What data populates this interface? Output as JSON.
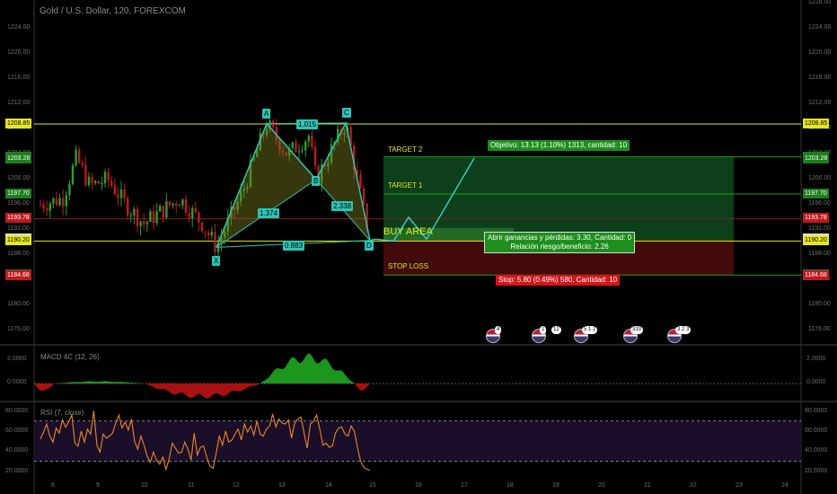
{
  "header": {
    "symbol_title": "Gold / U.S. Dollar, 120, FOREXCOM"
  },
  "colors": {
    "background": "#000000",
    "up": "#2e9e2e",
    "down": "#c0191c",
    "pattern": "#2ec4b6",
    "level": "#e6e61e",
    "target_zone": "#0f4a1e",
    "stop_zone": "#4a0b0b",
    "rsi": "#e8872a",
    "macd_pos": "#1e9e1e",
    "macd_neg": "#b01212"
  },
  "price_axis": {
    "ticks": [
      "1224.00",
      "1220.00",
      "1216.00",
      "1212.00",
      "1208.00",
      "1204.00",
      "1200.00",
      "1196.00",
      "1192.00",
      "1188.00",
      "1184.00",
      "1180.00",
      "1176.00"
    ],
    "right_ticks": [
      "1228.00",
      "1224.00",
      "1220.00",
      "1216.00",
      "1212.00",
      "1208.00",
      "1204.00",
      "1200.00",
      "1196.00",
      "1192.00",
      "1188.00",
      "1184.00",
      "1180.00",
      "1176.00"
    ],
    "ymin": 1173.8,
    "ymax": 1228.6
  },
  "price_labels": [
    {
      "v": "1208.85",
      "price": 1208.85,
      "bg": "#e6e61e",
      "fg": "#000"
    },
    {
      "v": "1203.61",
      "price": 1203.61,
      "bg": "#1e7e1e",
      "fg": "#fff"
    },
    {
      "v": "1203.28",
      "price": 1203.28,
      "bg": "#1e7e1e",
      "fg": "#fff"
    },
    {
      "v": "1197.70",
      "price": 1197.7,
      "bg": "#1e7e1e",
      "fg": "#fff"
    },
    {
      "v": "1193.78",
      "price": 1193.78,
      "bg": "#c0191c",
      "fg": "#fff"
    },
    {
      "v": "1190.48",
      "price": 1190.48,
      "bg": "#e0e0e0",
      "fg": "#000"
    },
    {
      "v": "1190.20",
      "price": 1190.2,
      "bg": "#e6e61e",
      "fg": "#000"
    },
    {
      "v": "1184.79",
      "price": 1184.79,
      "bg": "#1e7e1e",
      "fg": "#fff"
    },
    {
      "v": "1184.68",
      "price": 1184.68,
      "bg": "#c0191c",
      "fg": "#fff"
    }
  ],
  "x_axis": {
    "labels": [
      "6",
      "9",
      "10",
      "11",
      "12",
      "13",
      "14",
      "15",
      "16",
      "17",
      "18",
      "19",
      "20",
      "21",
      "22",
      "23",
      "24"
    ]
  },
  "chart_data": {
    "type": "candlestick",
    "title": "Gold / U.S. Dollar, 120, FOREXCOM",
    "horizontal_levels": [
      1208.85,
      1203.61,
      1197.7,
      1193.78,
      1190.2,
      1184.79
    ],
    "pattern_points": [
      {
        "name": "X",
        "price": 1189.2
      },
      {
        "name": "A",
        "price": 1208.9
      },
      {
        "name": "B",
        "price": 1200.0
      },
      {
        "name": "C",
        "price": 1209.0
      },
      {
        "name": "D",
        "price": 1190.3
      }
    ],
    "pattern_ratios": [
      "1.015",
      "1.374",
      "2.338",
      "0.883"
    ],
    "trade": {
      "target2_label": "TARGET 2",
      "target1_label": "TARGET 1",
      "buy_label": "BUY AREA",
      "stop_label": "STOP LOSS",
      "objective": "Objetivo: 13.13 (1.10%) 1313, cantidad: 10",
      "pnl": "Abrir ganancias y pérdidas: 3.30, Cantidad: 0",
      "ratio": "Relación riesgo/beneficio: 2.26",
      "stop": "Stop: 5.80 (0.49%) 580, Cantidad: 10"
    },
    "indicators": {
      "macd_label": "MACD 4C (12, 26)",
      "macd_ticks": [
        "2.0000",
        "0.0000"
      ],
      "rsi_label": "RSI (7, close)",
      "rsi_ticks": [
        "80.0000",
        "60.0000",
        "40.0000",
        "20.0000"
      ],
      "rsi_levels": [
        70,
        30
      ],
      "rsi_values": [
        52,
        59,
        67,
        55,
        49,
        63,
        58,
        71,
        64,
        69,
        76,
        48,
        45,
        60,
        49,
        62,
        57,
        80,
        46,
        39,
        57,
        53,
        55,
        58,
        68,
        76,
        63,
        69,
        61,
        72,
        50,
        42,
        55,
        46,
        35,
        29,
        39,
        31,
        27,
        34,
        22,
        32,
        48,
        43,
        38,
        39,
        49,
        42,
        31,
        58,
        36,
        44,
        45,
        34,
        25,
        23,
        38,
        55,
        46,
        60,
        49,
        51,
        57,
        62,
        51,
        67,
        59,
        65,
        56,
        70,
        57,
        55,
        62,
        65,
        77,
        64,
        72,
        68,
        67,
        71,
        53,
        68,
        72,
        74,
        58,
        43,
        67,
        70,
        76,
        62,
        46,
        48,
        44,
        45,
        58,
        63,
        64,
        57,
        55,
        65,
        60,
        44,
        30,
        24,
        22,
        21
      ]
    },
    "events": [
      "4",
      "1",
      "12",
      "5 1 2",
      "333",
      "3 2 3"
    ]
  }
}
